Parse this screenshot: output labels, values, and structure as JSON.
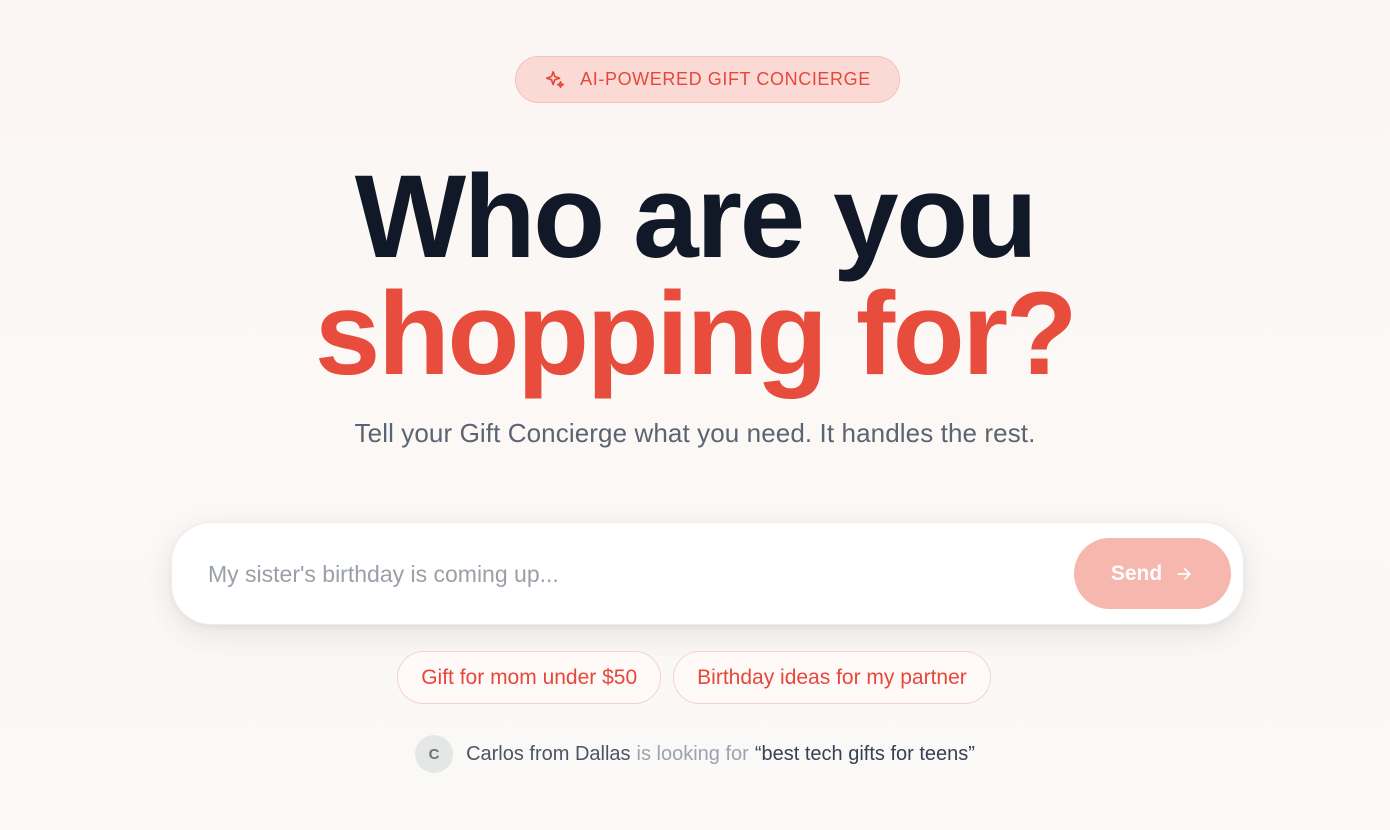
{
  "badge": {
    "icon": "sparkles-icon",
    "label": "AI-POWERED GIFT CONCIERGE"
  },
  "hero": {
    "line1": "Who are you",
    "line2": "shopping for?",
    "subtitle": "Tell your Gift Concierge what you need. It handles the rest."
  },
  "chat": {
    "placeholder": "My sister's birthday is coming up...",
    "value": "",
    "send_label": "Send",
    "send_icon": "arrow-right-icon"
  },
  "suggestions": [
    {
      "label": "Gift for mom under $50"
    },
    {
      "label": "Birthday ideas for my partner"
    }
  ],
  "activity": {
    "avatar_initial": "C",
    "name": "Carlos from Dallas",
    "verb": "is looking for",
    "query": "“best tech gifts for teens”"
  },
  "colors": {
    "accent": "#e74c3c",
    "heading": "#111827",
    "badge_bg": "#fbdad5",
    "send_bg": "#f6b7af"
  }
}
